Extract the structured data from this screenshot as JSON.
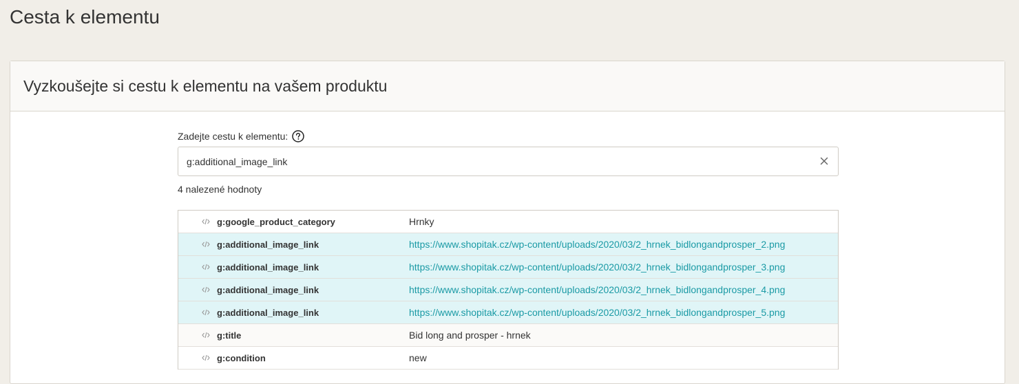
{
  "page": {
    "title": "Cesta k elementu"
  },
  "card": {
    "title": "Vyzkoušejte si cestu k elementu na vašem produktu"
  },
  "form": {
    "label": "Zadejte cestu k elementu:",
    "input_value": "g:additional_image_link",
    "result_count": "4 nalezené hodnoty"
  },
  "colors": {
    "highlight_row": "#e0f5f7",
    "link": "#1a9aa5",
    "background": "#f1eee8"
  },
  "results": [
    {
      "key": "g:google_product_category",
      "value": "Hrnky",
      "highlight": false,
      "link": false
    },
    {
      "key": "g:additional_image_link",
      "value": "https://www.shopitak.cz/wp-content/uploads/2020/03/2_hrnek_bidlongandprosper_2.png",
      "highlight": true,
      "link": true
    },
    {
      "key": "g:additional_image_link",
      "value": "https://www.shopitak.cz/wp-content/uploads/2020/03/2_hrnek_bidlongandprosper_3.png",
      "highlight": true,
      "link": true
    },
    {
      "key": "g:additional_image_link",
      "value": "https://www.shopitak.cz/wp-content/uploads/2020/03/2_hrnek_bidlongandprosper_4.png",
      "highlight": true,
      "link": true
    },
    {
      "key": "g:additional_image_link",
      "value": "https://www.shopitak.cz/wp-content/uploads/2020/03/2_hrnek_bidlongandprosper_5.png",
      "highlight": true,
      "link": true
    },
    {
      "key": "g:title",
      "value": "Bid long and prosper - hrnek",
      "highlight": false,
      "link": false
    },
    {
      "key": "g:condition",
      "value": "new",
      "highlight": false,
      "link": false
    }
  ]
}
